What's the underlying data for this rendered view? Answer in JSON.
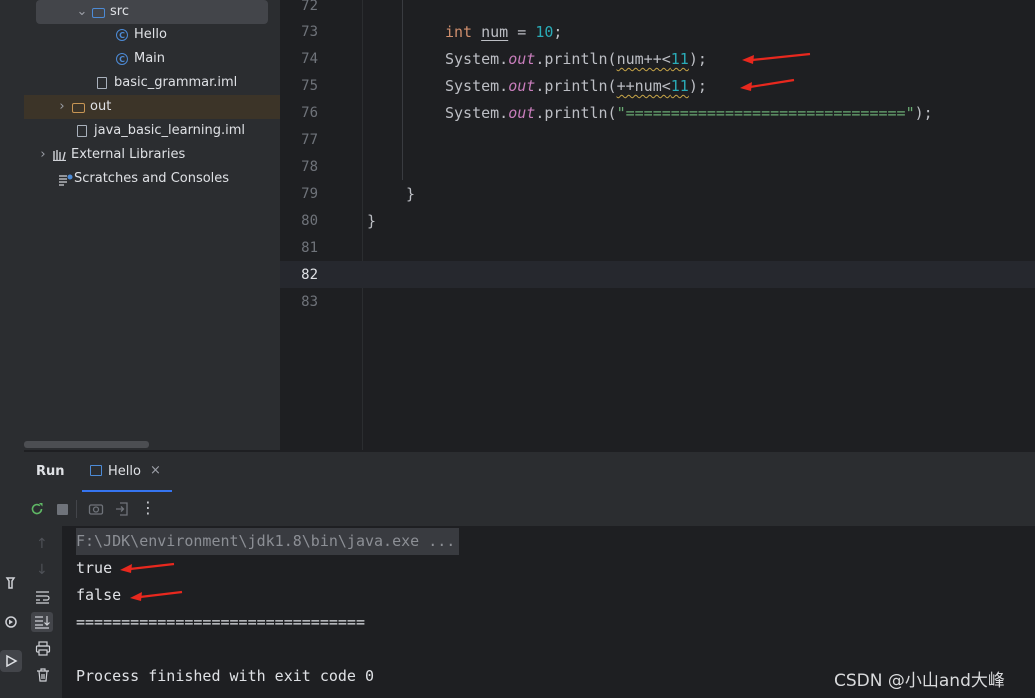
{
  "project_tree": {
    "items": [
      {
        "label": "src",
        "kind": "folder"
      },
      {
        "label": "Hello",
        "kind": "class"
      },
      {
        "label": "Main",
        "kind": "class"
      },
      {
        "label": "basic_grammar.iml",
        "kind": "file"
      },
      {
        "label": "out",
        "kind": "folder"
      },
      {
        "label": "java_basic_learning.iml",
        "kind": "file"
      },
      {
        "label": "External Libraries",
        "kind": "library"
      },
      {
        "label": "Scratches and Consoles",
        "kind": "scratch"
      }
    ]
  },
  "editor": {
    "line_numbers": [
      "72",
      "73",
      "74",
      "75",
      "76",
      "77",
      "78",
      "79",
      "80",
      "81",
      "82",
      "83"
    ],
    "current_line": "82",
    "code": {
      "l73_kw": "int",
      "l73_var": "num",
      "l73_eq": " = ",
      "l73_val": "10",
      "l73_end": ";",
      "sys": "System.",
      "out": "out",
      "println": ".println(",
      "l74_arg": "num++<",
      "l74_num": "11",
      "l75_arg": "++num<",
      "l75_num": "11",
      "close": ");",
      "l76_str": "\"===============================\"",
      "brace": "}"
    }
  },
  "run_panel": {
    "title": "Run",
    "tab_label": "Hello",
    "console_lines": {
      "cmd": "F:\\JDK\\environment\\jdk1.8\\bin\\java.exe ...",
      "out1": "true",
      "out2": "false",
      "sep": "================================",
      "exit": "Process finished with exit code 0"
    }
  },
  "watermark": "CSDN @小山and大峰",
  "colors": {
    "annotation_arrow": "#e8281e",
    "keyword": "#cf8e6d",
    "number": "#2aacb8",
    "static_field": "#c77dbb",
    "string": "#6aab73"
  }
}
